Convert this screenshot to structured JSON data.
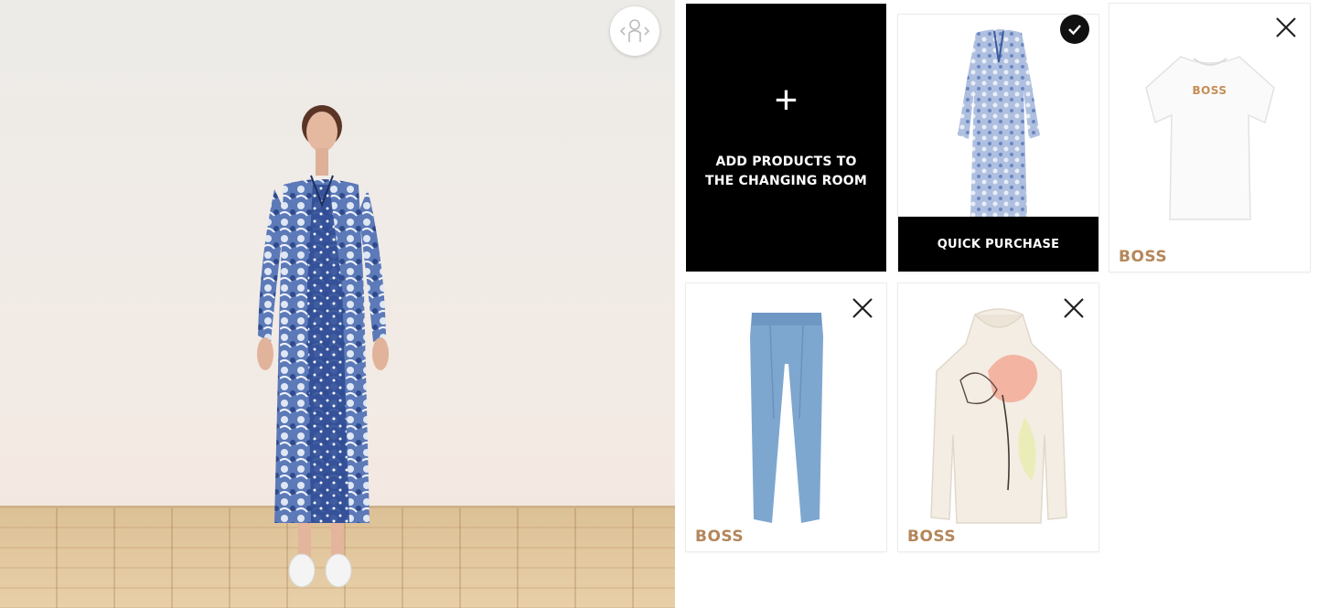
{
  "room": {
    "view_icon": "360-view-icon"
  },
  "changing_room": {
    "add_card": {
      "plus_icon": "+",
      "label": "ADD PRODUCTS TO\nTHE CHANGING ROOM"
    },
    "products": [
      {
        "name": "patchwork-print-maxi-dress",
        "selected": true,
        "action_label": "QUICK PURCHASE",
        "brand": ""
      },
      {
        "name": "boss-logo-tshirt",
        "selected": false,
        "brand": "BOSS",
        "logo_text": "BOSS"
      },
      {
        "name": "light-blue-trousers",
        "selected": false,
        "brand": "BOSS"
      },
      {
        "name": "floral-print-hoodie",
        "selected": false,
        "brand": "BOSS"
      }
    ]
  },
  "colors": {
    "brand": "#b4865a",
    "accent": "#000000"
  }
}
